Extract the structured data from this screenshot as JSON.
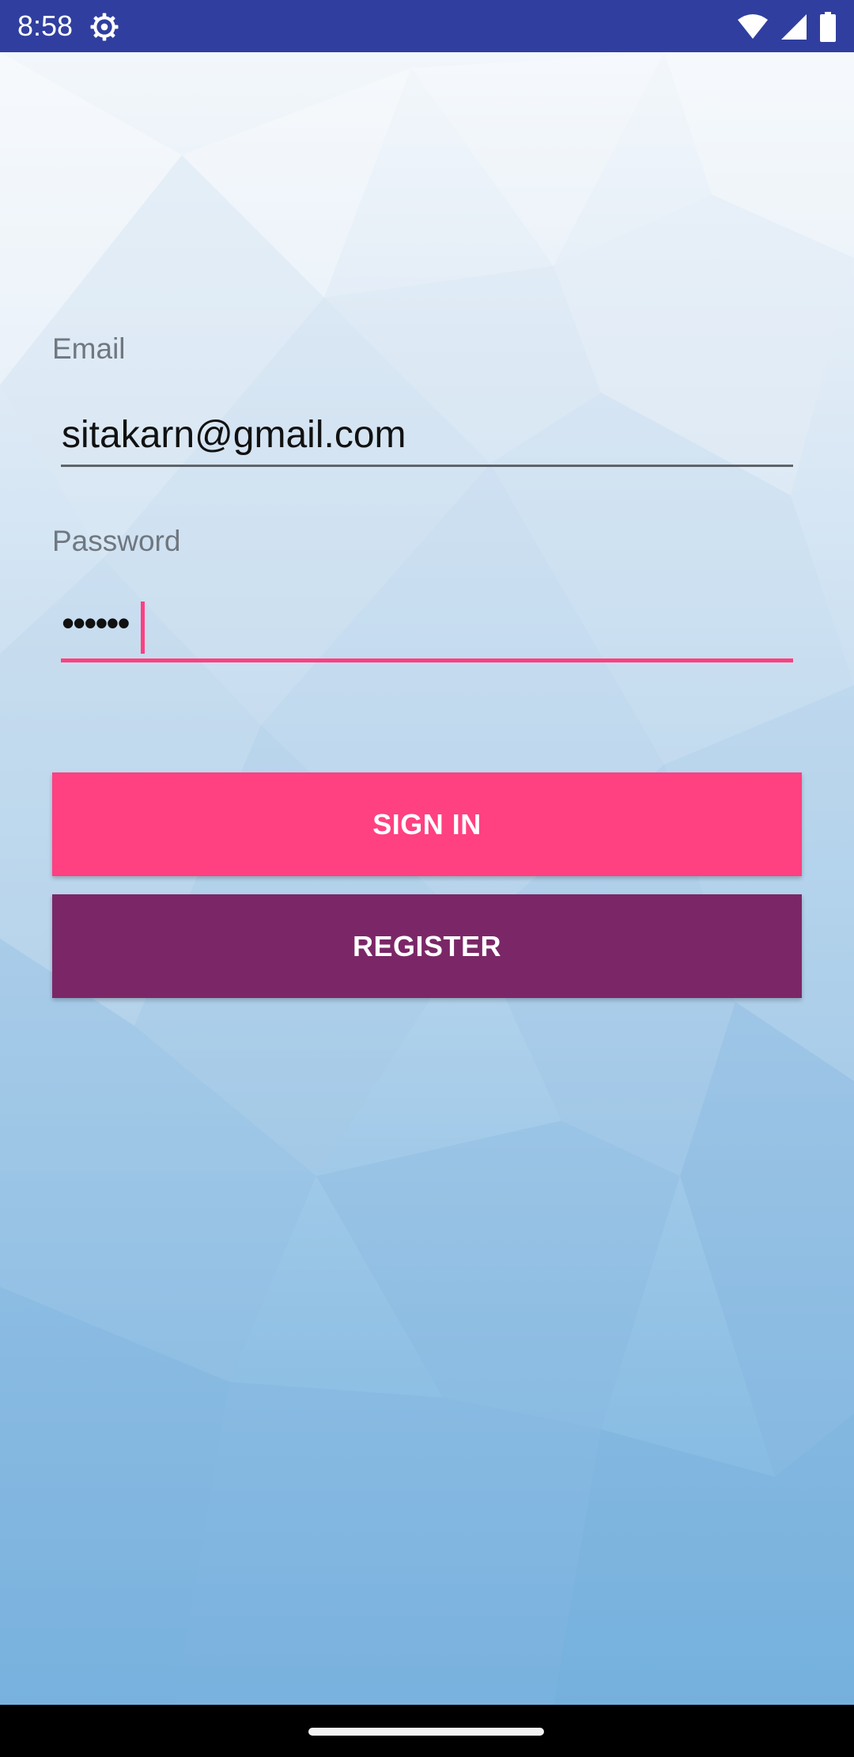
{
  "status_bar": {
    "time": "8:58",
    "icons": [
      "settings-gear-icon",
      "wifi-icon",
      "signal-icon",
      "battery-icon"
    ]
  },
  "form": {
    "email": {
      "label": "Email",
      "value": "sitakarn@gmail.com"
    },
    "password": {
      "label": "Password",
      "value": "••••••"
    }
  },
  "buttons": {
    "sign_in": "SIGN IN",
    "register": "REGISTER"
  },
  "colors": {
    "status_bar": "#303f9f",
    "accent": "#ff4081",
    "register_button": "#7b2767",
    "email_underline": "#5f6368",
    "navigation_bar": "#000000"
  }
}
